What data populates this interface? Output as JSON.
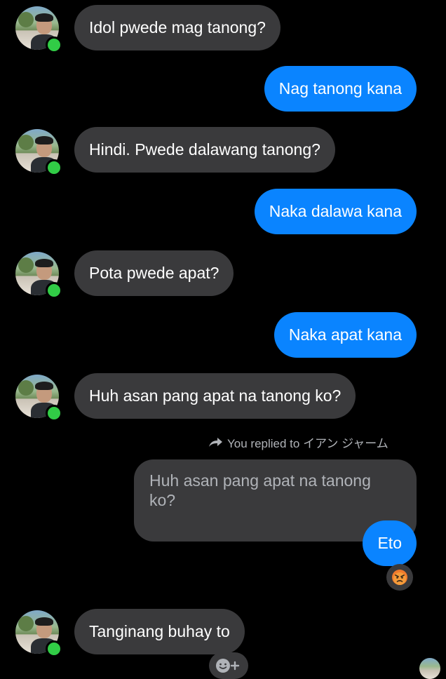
{
  "messages": [
    {
      "direction": "in",
      "text": "Idol pwede mag tanong?"
    },
    {
      "direction": "out",
      "text": "Nag tanong kana"
    },
    {
      "direction": "in",
      "text": "Hindi. Pwede dalawang tanong?"
    },
    {
      "direction": "out",
      "text": "Naka dalawa kana"
    },
    {
      "direction": "in",
      "text": "Pota pwede apat?"
    },
    {
      "direction": "out",
      "text": "Naka apat kana"
    },
    {
      "direction": "in",
      "text": "Huh asan pang apat na tanong ko?"
    },
    {
      "direction": "out",
      "text": "Eto",
      "reply_to_text": "Huh asan pang apat na tanong ko?"
    },
    {
      "direction": "in",
      "text": "Tanginang buhay to"
    }
  ],
  "reply_label": "You replied to イアン ジャーム",
  "reaction_icon": "angry-face-icon",
  "colors": {
    "background": "#000000",
    "incoming_bubble": "#3a3a3c",
    "outgoing_bubble": "#0a84ff",
    "online_dot": "#31cc46",
    "muted_text": "#b0b3b8"
  }
}
